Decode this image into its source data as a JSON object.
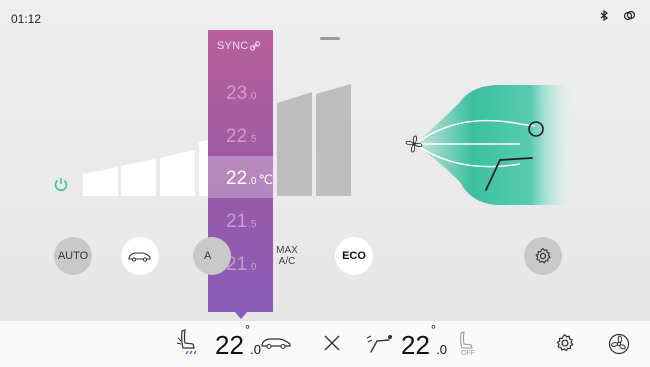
{
  "status": {
    "time": "01:12",
    "icons": [
      "bluetooth-icon",
      "link-icon"
    ]
  },
  "picker": {
    "sync_label": "SYNC",
    "temps": [
      {
        "main": "23",
        "dec": ".0"
      },
      {
        "main": "22",
        "dec": ".5"
      },
      {
        "main": "22",
        "dec": ".0",
        "unit": "℃"
      },
      {
        "main": "21",
        "dec": ".5"
      },
      {
        "main": "21",
        "dec": ".0"
      }
    ]
  },
  "buttons": {
    "auto": "AUTO",
    "a_partial": "A",
    "max_ac_line1": "MAX",
    "max_ac_line2": "A/C",
    "eco": "ECO"
  },
  "fan": {
    "level": 5,
    "max": 7
  },
  "bottom": {
    "left_temp_int": "22",
    "left_temp_dec": ".0",
    "degree": "°",
    "right_temp_int": "22",
    "right_temp_dec": ".0",
    "seat_status": "OFF"
  },
  "colors": {
    "accent": "#3bbfa0",
    "picker_top": "#b7609b",
    "picker_bottom": "#8a5cb8"
  }
}
